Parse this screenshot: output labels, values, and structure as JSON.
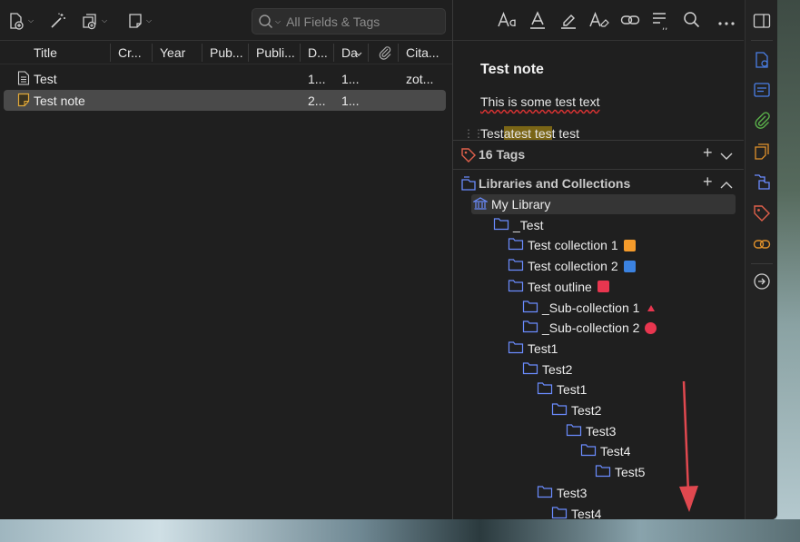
{
  "toolbar": {
    "search_placeholder": "All Fields & Tags"
  },
  "columns": [
    {
      "label": "Title"
    },
    {
      "label": "Cr..."
    },
    {
      "label": "Year"
    },
    {
      "label": "Pub..."
    },
    {
      "label": "Publi..."
    },
    {
      "label": "D..."
    },
    {
      "label": "Da"
    },
    {
      "label": "Cita..."
    }
  ],
  "items": [
    {
      "title": "Test",
      "d": "1...",
      "da": "1...",
      "cita": "zot...",
      "selected": false,
      "icon": "document-icon"
    },
    {
      "title": "Test note",
      "d": "2...",
      "da": "1...",
      "cita": "",
      "selected": true,
      "icon": "note-icon"
    }
  ],
  "note": {
    "title": "Test note",
    "line1": "This is some test text",
    "line2_pre": "Test",
    "line2_hl": "atest tes",
    "line2_post": "t test"
  },
  "tags_section": {
    "label": "16 Tags"
  },
  "collections_section": {
    "label": "Libraries and Collections"
  },
  "tree": [
    {
      "label": "My Library",
      "level": 0,
      "icon": "library-icon",
      "selected": true
    },
    {
      "label": "_Test",
      "level": 1,
      "icon": "folder-icon"
    },
    {
      "label": "Test collection 1",
      "level": 2,
      "icon": "folder-icon",
      "emoji_color": "#f59b2b",
      "emoji_shape": "square"
    },
    {
      "label": "Test collection 2",
      "level": 2,
      "icon": "folder-icon",
      "emoji_color": "#3b82e0",
      "emoji_shape": "square"
    },
    {
      "label": "Test outline",
      "level": 2,
      "icon": "folder-icon",
      "emoji_color": "#e8364f",
      "emoji_shape": "square"
    },
    {
      "label": "_Sub-collection 1",
      "level": 3,
      "icon": "folder-icon",
      "emoji_color": "#e8364f",
      "emoji_shape": "triangle"
    },
    {
      "label": "_Sub-collection 2",
      "level": 3,
      "icon": "folder-icon",
      "emoji_color": "#e8364f",
      "emoji_shape": "circle"
    },
    {
      "label": "Test1",
      "level": 2,
      "icon": "folder-icon"
    },
    {
      "label": "Test2",
      "level": 3,
      "icon": "folder-icon"
    },
    {
      "label": "Test1",
      "level": 4,
      "icon": "folder-icon"
    },
    {
      "label": "Test2",
      "level": 5,
      "icon": "folder-icon"
    },
    {
      "label": "Test3",
      "level": 6,
      "icon": "folder-icon"
    },
    {
      "label": "Test4",
      "level": 7,
      "icon": "folder-icon"
    },
    {
      "label": "Test5",
      "level": 8,
      "icon": "folder-icon"
    },
    {
      "label": "Test3",
      "level": 4,
      "icon": "folder-icon"
    },
    {
      "label": "Test4",
      "level": 5,
      "icon": "folder-icon"
    }
  ],
  "colors": {
    "accent_blue": "#6b8cff",
    "sidenav_blue": "#4a7fe6",
    "sidenav_green": "#5ab04a",
    "sidenav_orange": "#e0912b",
    "sidenav_red_tag": "#e0604b",
    "highlight_yellow": "#7a6516",
    "annotation_red": "#e0484f"
  }
}
